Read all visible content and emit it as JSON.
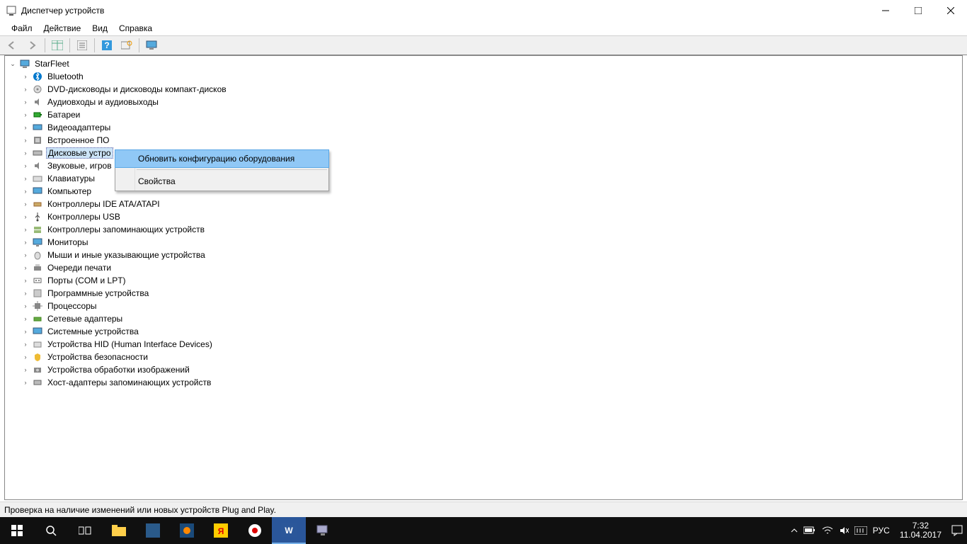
{
  "window": {
    "title": "Диспетчер устройств"
  },
  "menu": {
    "file": "Файл",
    "action": "Действие",
    "view": "Вид",
    "help": "Справка"
  },
  "tree": {
    "root": "StarFleet",
    "items": [
      "Bluetooth",
      "DVD-дисководы и дисководы компакт-дисков",
      "Аудиовходы и аудиовыходы",
      "Батареи",
      "Видеоадаптеры",
      "Встроенное ПО",
      "Дисковые устро",
      "Звуковые, игров",
      "Клавиатуры",
      "Компьютер",
      "Контроллеры IDE ATA/ATAPI",
      "Контроллеры USB",
      "Контроллеры запоминающих устройств",
      "Мониторы",
      "Мыши и иные указывающие устройства",
      "Очереди печати",
      "Порты (COM и LPT)",
      "Программные устройства",
      "Процессоры",
      "Сетевые адаптеры",
      "Системные устройства",
      "Устройства HID (Human Interface Devices)",
      "Устройства безопасности",
      "Устройства обработки изображений",
      "Хост-адаптеры запоминающих устройств"
    ]
  },
  "context": {
    "scan": "Обновить конфигурацию оборудования",
    "props": "Свойства"
  },
  "status": "Проверка на наличие изменений или новых устройств Plug and Play.",
  "tray": {
    "lang": "РУС",
    "time": "7:32",
    "date": "11.04.2017"
  }
}
